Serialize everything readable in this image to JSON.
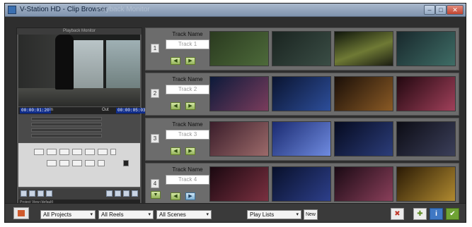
{
  "window": {
    "title": "V-Station HD - Clip Browser",
    "ghost_title": "Playback Monitor",
    "min_label": "–",
    "max_label": "□",
    "close_label": "✕"
  },
  "monitor": {
    "title": "Playback Monitor",
    "timecode_in": "00:00:01:20",
    "timecode_out": "00:00:05:03",
    "tag_in": "In",
    "tag_out": "Out",
    "project_view_label": "Project View (default)"
  },
  "track_name_label": "Track Name",
  "tracks": [
    {
      "number": "1",
      "name": "Track 1"
    },
    {
      "number": "2",
      "name": "Track 2"
    },
    {
      "number": "3",
      "name": "Track 3"
    },
    {
      "number": "4",
      "name": "Track 4"
    }
  ],
  "arrows": {
    "left": "◀",
    "right": "▶",
    "up": "▲",
    "down": "▼"
  },
  "bottombar": {
    "projects_dropdown": "All Projects",
    "reels_dropdown": "All Reels",
    "scenes_dropdown": "All Scenes",
    "playlists_dropdown": "Play Lists",
    "new_button": "New",
    "caret": "▾"
  },
  "icons": {
    "delete": "✖",
    "confirm": "✔",
    "info": "i",
    "add": "✚"
  },
  "colors": {
    "accent_green": "#94b45a",
    "timecode_blue": "#0f2c8a",
    "track_bg": "#6c6c6c",
    "window_bg": "#2e2e2e"
  }
}
